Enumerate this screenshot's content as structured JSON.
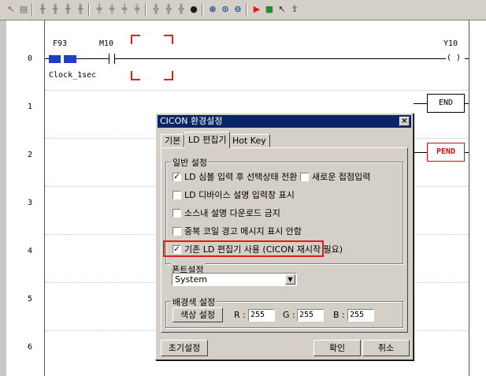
{
  "ladder": {
    "rows": [
      "0",
      "1",
      "2",
      "3",
      "4",
      "5",
      "6"
    ],
    "contact_f93": "F93",
    "contact_m10": "M10",
    "coil_y10": "Y10",
    "coil_symbol": "(   )",
    "comment_clock": "Clock_1sec",
    "end_instruction": "END",
    "pend_instruction": "PEND"
  },
  "dialog": {
    "title": "CICON 환경설정",
    "close": "×",
    "tabs": [
      "기본",
      "LD 편집기",
      "Hot Key"
    ],
    "active_tab": "LD 편집기",
    "general": {
      "title": "일반 설정",
      "options": [
        {
          "label": "LD 심볼 입력 후 선택상태 전환",
          "checked": true,
          "mark": "✓"
        },
        {
          "label": "새로운 접점입력",
          "checked": false,
          "mark": ""
        },
        {
          "label": "LD 디바이스 설명 입력창 표시",
          "checked": false,
          "mark": ""
        },
        {
          "label": "소스내 설명 다운로드 금지",
          "checked": false,
          "mark": ""
        },
        {
          "label": "중복 코일 경고 메시지 표시 안함",
          "checked": false,
          "mark": ""
        },
        {
          "label": "기존 LD 편집기 사용 (CICON  재시작 필요)",
          "checked": true,
          "mark": "✓"
        }
      ]
    },
    "font": {
      "title": "폰트설정",
      "selected": "System",
      "arrow": "▼"
    },
    "background": {
      "title": "배경색 설정",
      "color_button": "색상 설정",
      "r_label": "R :",
      "r_value": "255",
      "g_label": "G :",
      "g_value": "255",
      "b_label": "B :",
      "b_value": "255"
    },
    "buttons": {
      "reset": "초기설정",
      "ok": "확인",
      "cancel": "취소"
    }
  },
  "toolbar": {
    "icons": [
      "pointer-icon",
      "edit-icon",
      "contact-no-icon",
      "contact-nc-icon",
      "contact-rise-icon",
      "contact-fall-icon",
      "coil-icon",
      "coil-set-icon",
      "coil-reset-icon",
      "coil-rise-icon",
      "func-icon",
      "func2-icon",
      "func3-icon",
      "comment-icon",
      "zoom-in-icon",
      "zoom-default-icon",
      "zoom-out-icon",
      "run-icon",
      "monitor-icon",
      "cursor-icon",
      "upload-icon"
    ]
  },
  "colors": {
    "selection": "#1f3fc8",
    "marker": "#e02020",
    "title_bar": "#0a246a",
    "highlight": "#e01c1c",
    "pend": "#cc1010"
  }
}
